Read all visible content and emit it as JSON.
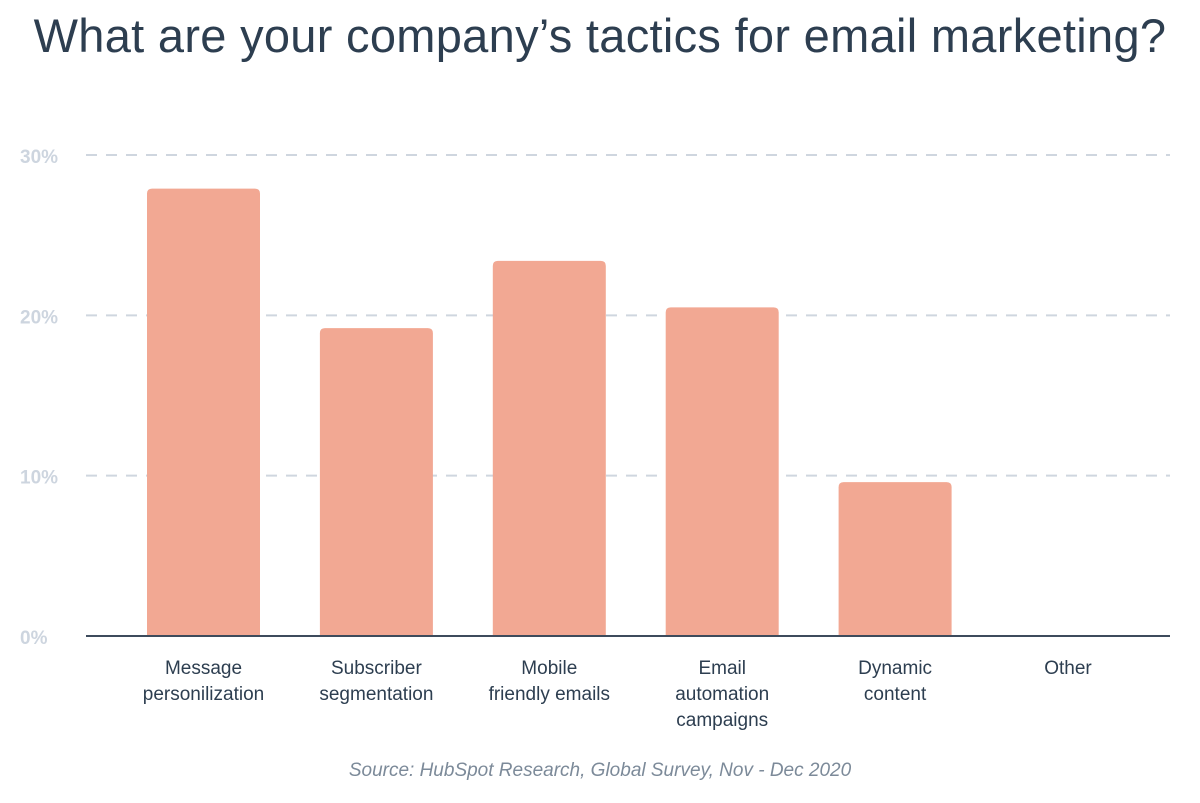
{
  "title": "What are your company’s tactics for email marketing?",
  "source": "Source: HubSpot Research, Global Survey, Nov - Dec 2020",
  "colors": {
    "bar": "#f2a893",
    "grid": "#cfd6df",
    "axis": "#3d4b5c",
    "title": "#2d3e50",
    "tick_label": "#cdd5df",
    "category_label": "#2d3e50",
    "source": "#7c8a99"
  },
  "chart_data": {
    "type": "bar",
    "title": "What are your company’s tactics for email marketing?",
    "xlabel": "",
    "ylabel": "",
    "categories": [
      [
        "Message",
        "personilization"
      ],
      [
        "Subscriber",
        "segmentation"
      ],
      [
        "Mobile",
        "friendly emails"
      ],
      [
        "Email",
        "automation",
        "campaigns"
      ],
      [
        "Dynamic",
        "content"
      ],
      [
        "Other"
      ]
    ],
    "values": [
      27.9,
      19.2,
      23.4,
      20.5,
      9.6,
      0
    ],
    "unit": "%",
    "ylim": [
      0,
      30
    ],
    "yticks": [
      0,
      10,
      20,
      30
    ],
    "ytick_labels": [
      "0%",
      "10%",
      "20%",
      "30%"
    ],
    "grid": true,
    "grid_style": "dashed",
    "legend": "none",
    "annotation": "Source: HubSpot Research, Global Survey, Nov - Dec 2020"
  }
}
